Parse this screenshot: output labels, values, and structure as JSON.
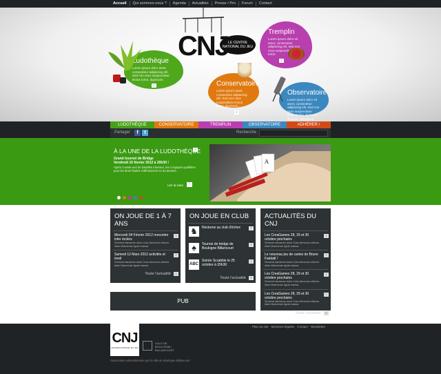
{
  "topnav": [
    "Accueil",
    "Qui sommes-nous ?",
    "Agenda",
    "Actualités",
    "Presse / Pro",
    "Forum",
    "Contact"
  ],
  "hero": {
    "logo": "CNJ",
    "logo_sub": "LE CENTRE NATIONAL DU JEU",
    "ludotheque": {
      "title": "Ludothèque",
      "text": "Lorem ipsum dolor amet, consectetur adipiscing elit. Sed non risus suspendisse lectus tortor, dignissim."
    },
    "tremplin": {
      "title": "Tremplin",
      "text": "Lorem ipsum dolor sit amet, consectetur adipiscing elit. Sed non risus suspendisse lectus tortor."
    },
    "conservatoire": {
      "title": "Conservatoire",
      "text": "Lorem ipsum amet, consectetur adipiscing elit. Sed non risus suspendisse lectus tortor, dignissim."
    },
    "observatoire": {
      "title": "Observatoire",
      "text": "Lorem ipsum dolor sit amet, consectetur adipiscing elit. Sed non risus suspendisse lectus tortor, dignissim sit amet, adipiscing nec, dui dé ultricies."
    }
  },
  "mainnav": [
    {
      "label": "LUDOTHÈQUE",
      "color": "#48a018"
    },
    {
      "label": "CONSERVATOIRE",
      "color": "#e07a10"
    },
    {
      "label": "TREMPLIN",
      "color": "#b83fae"
    },
    {
      "label": "OBSERVATOIRE",
      "color": "#3b88bf"
    },
    {
      "label": "ADHÉRER / SOUTENIR",
      "color": "#d04a18"
    }
  ],
  "share": {
    "label": "Partager",
    "search_label": "Recherche"
  },
  "feature": {
    "title": "À LA UNE DE LA LUDOTHÈQUE",
    "h1": "Grand tournoi de Bridge",
    "h2": "Vendredi 10 février 2012 à 20h30 !",
    "text": "Après 3 week-end de batailles intenses, les 4 équipes qualifiées pour les demi-finales s'affronteront en 64 donnes.",
    "more": "Lire la suite",
    "dots": [
      "#ffffff",
      "#e07a10",
      "#b83fae",
      "#3b88bf",
      "#d04a18"
    ]
  },
  "col1": {
    "title": "ON JOUE DE 1 À 7 ANS",
    "items": [
      {
        "title": "Mercredi 04 Février 2012 rencontre inter écoles",
        "desc": "Semend danseres dolor Cras elemoum ultrices diam Maecenas ligula massa."
      },
      {
        "title": "Samedi 12 Mars 2012 activités et éveil",
        "desc": "Semend danseres dolor Cras elemoum ultrices diam Maecenas ligula massa."
      }
    ],
    "more": "Toute l'actualité"
  },
  "col2": {
    "title": "ON JOUE EN CLUB",
    "items": [
      {
        "title": "Nocturne au club d'échec"
      },
      {
        "title": "Tournoi de bridge de Boulogne Billancourt"
      },
      {
        "title": "Soirée Scrabble le 25 octobre à 20h30"
      }
    ],
    "more": "Toute l'actualité"
  },
  "col3": {
    "title": "ACTUALITÉS DU CNJ",
    "items": [
      {
        "title": "Les CreaGames 28, 29 et 30 octobre prochains",
        "desc": "Semend danseres dolor Cras elemoum ultrices diam Maecenas ligula massa."
      },
      {
        "title": "Le nouveau jeu de cartes de Bruno Faidutti !",
        "desc": "Semend danseres dolor Cras elemoum ultrices diam Maecenas ligula massa."
      },
      {
        "title": "Les CreaGames 28, 29 et 30 octobre prochains",
        "desc": "Semend danseres dolor Cras elemoum ultrices diam Maecenas ligula massa."
      },
      {
        "title": "Les CreaGames 28, 29 et 30 octobre prochains",
        "desc": "Semend danseres dolor Cras elemoum ultrices diam Maecenas ligula massa."
      }
    ],
    "more": "Toute l'actualité"
  },
  "pub": "PUB",
  "footer": {
    "links": [
      "Plan du site",
      "Mentions légales",
      "Contact",
      "Newsletter"
    ],
    "logo": "CNJ",
    "logo_sub": "CENTRE NATIONAL DU JEU",
    "city": "VILLE DE BOULOGNE-BILLANCOURT",
    "note": "Association subventionnée par la ville de Boulogne-Billancourt"
  }
}
